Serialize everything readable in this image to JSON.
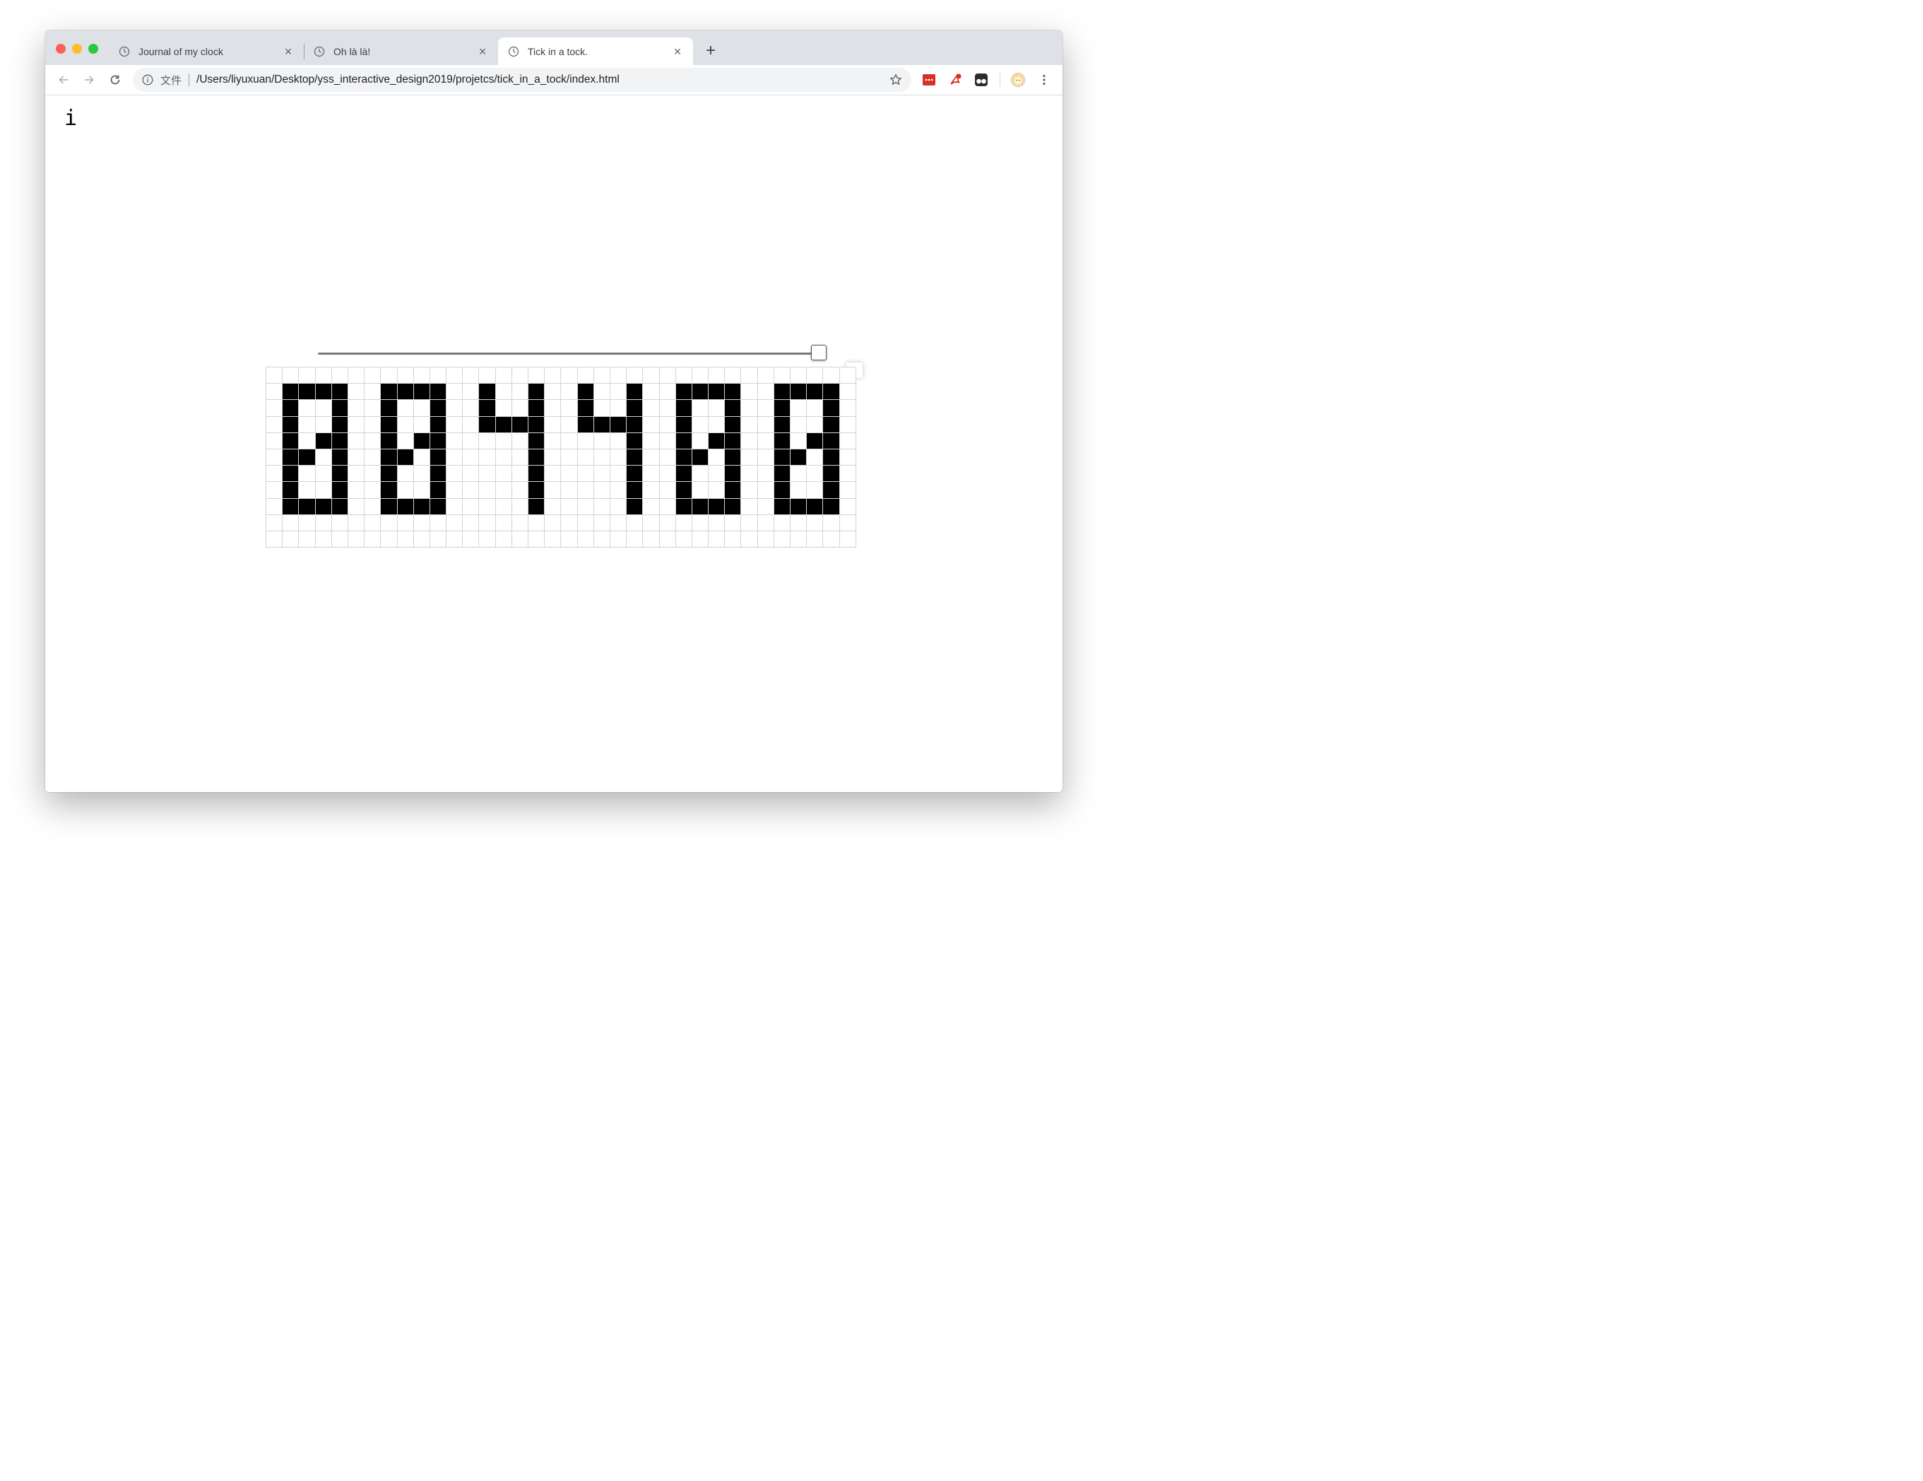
{
  "browser": {
    "tabs": [
      {
        "title": "Journal of my clock",
        "active": false
      },
      {
        "title": "Oh là là!",
        "active": false
      },
      {
        "title": "Tick in a tock.",
        "active": true
      }
    ],
    "file_label": "文件",
    "url": "/Users/liyuxuan/Desktop/yss_interactive_design2019/projetcs/tick_in_a_tock/index.html",
    "extensions": [
      "red-dots-extension-icon",
      "acrobat-extension-icon",
      "tampermonkey-icon"
    ],
    "colors": {
      "tabbar": "#dee1e6",
      "close": "#ff5f57",
      "minimize": "#febc2e",
      "maximize": "#28c840"
    }
  },
  "page": {
    "info_glyph": "i",
    "slider": {
      "value_fraction": 0.98
    },
    "pixel_display": {
      "rows": 11,
      "cols": 36,
      "on_color": "#000000",
      "off_color": "#ffffff",
      "grid_color": "#d3d3d3",
      "pattern": [
        "....................................",
        ".####..####..#..#..#..#..####..####.",
        ".#..#..#..#..#..#..#..#..#..#..#..#.",
        ".#..#..#..#..####..####..#..#..#..#.",
        ".#.##..#.##.....#.....#..#.##..#.##.",
        ".##.#..##.#.....#.....#..##.#..##.#.",
        ".#..#..#..#.....#.....#..#..#..#..#.",
        ".#..#..#..#.....#.....#..#..#..#..#.",
        ".####..####.....#.....#..####..####.",
        "....................................",
        "...................................."
      ]
    }
  }
}
